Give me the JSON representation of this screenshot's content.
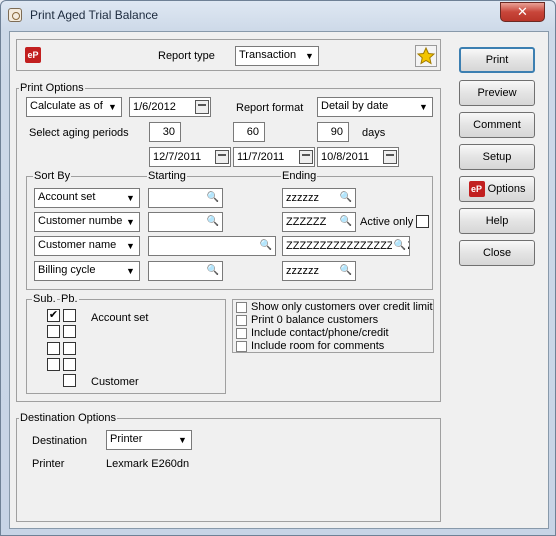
{
  "window": {
    "title": "Print Aged Trial Balance",
    "close_glyph": "✕"
  },
  "header": {
    "logo_text": "eP",
    "report_type_label": "Report type",
    "report_type_value": "Transaction",
    "favorite_icon": "star-icon"
  },
  "print_options": {
    "label": "Print Options",
    "calculate_select": "Calculate as of",
    "as_of_date": "1/6/2012",
    "report_format_label": "Report format",
    "report_format_value": "Detail by date",
    "aging_label": "Select aging periods",
    "periods": [
      "30",
      "60",
      "90"
    ],
    "days_label": "days",
    "period_dates": [
      "12/7/2011",
      "11/7/2011",
      "10/8/2011"
    ]
  },
  "sort": {
    "sort_by_label": "Sort By",
    "starting_label": "Starting",
    "ending_label": "Ending",
    "active_only_label": "Active only",
    "rows": [
      {
        "field": "Account set",
        "starting": "",
        "ending": "zzzzzz"
      },
      {
        "field": "Customer number",
        "starting": "",
        "ending": "ZZZZZZ"
      },
      {
        "field": "Customer name",
        "starting": "",
        "ending": "ZZZZZZZZZZZZZZZZZZZ"
      },
      {
        "field": "Billing cycle",
        "starting": "",
        "ending": "zzzzzz"
      }
    ]
  },
  "subtotals": {
    "sub_label": "Sub.",
    "pb_label": "Pb.",
    "check_mark": "✔",
    "account_set_label": "Account set",
    "customer_label": "Customer"
  },
  "checkbox_options": [
    "Show only customers over credit limit",
    "Print 0 balance customers",
    "Include contact/phone/credit",
    "Include room for comments"
  ],
  "destination": {
    "label": "Destination Options",
    "destination_label": "Destination",
    "destination_value": "Printer",
    "printer_label": "Printer",
    "printer_value": "Lexmark E260dn"
  },
  "buttons": {
    "print": "Print",
    "preview": "Preview",
    "comment": "Comment",
    "setup": "Setup",
    "options": "Options",
    "help": "Help",
    "close": "Close"
  },
  "icons": {
    "lookup": "🔍",
    "dropdown": "▼"
  }
}
